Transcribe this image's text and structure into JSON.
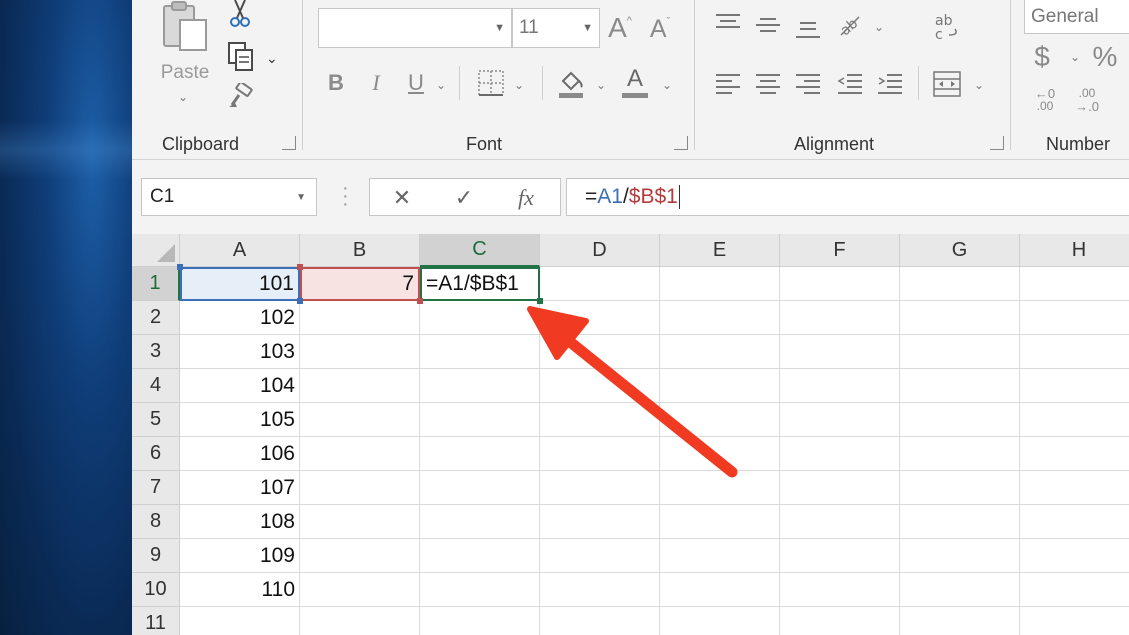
{
  "ribbon": {
    "clipboard": {
      "label": "Clipboard",
      "paste_label": "Paste"
    },
    "font": {
      "label": "Font",
      "font_name_value": "",
      "font_size_value": "11",
      "grow_font_glyph": "A",
      "shrink_font_glyph": "A",
      "bold_glyph": "B",
      "italic_glyph": "I",
      "underline_glyph": "U",
      "font_color_glyph": "A"
    },
    "alignment": {
      "label": "Alignment"
    },
    "number": {
      "label": "Number",
      "format_value": "General",
      "currency_glyph": "$",
      "percent_glyph": "%",
      "increase_decimal_text": ".00",
      "decrease_decimal_text": ".00"
    }
  },
  "formula_bar": {
    "name_box_value": "C1",
    "cancel_glyph": "✕",
    "enter_glyph": "✓",
    "fx_glyph": "fx",
    "formula_prefix": "=",
    "formula_ref_a": "A1",
    "formula_sep": "/",
    "formula_ref_b": "$B$1"
  },
  "grid": {
    "columns": [
      "A",
      "B",
      "C",
      "D",
      "E",
      "F",
      "G",
      "H"
    ],
    "rows": [
      "1",
      "2",
      "3",
      "4",
      "5",
      "6",
      "7",
      "8",
      "9",
      "10",
      "11"
    ],
    "col_a_values": [
      "101",
      "102",
      "103",
      "104",
      "105",
      "106",
      "107",
      "108",
      "109",
      "110"
    ],
    "b1_value": "7",
    "c1_value": "=A1/$B$1",
    "active_cell": "C1"
  },
  "colors": {
    "excel_green": "#217346",
    "ref_blue": "#3c6fb7",
    "ref_red": "#b53a3a",
    "annotation_arrow": "#f03a22"
  }
}
